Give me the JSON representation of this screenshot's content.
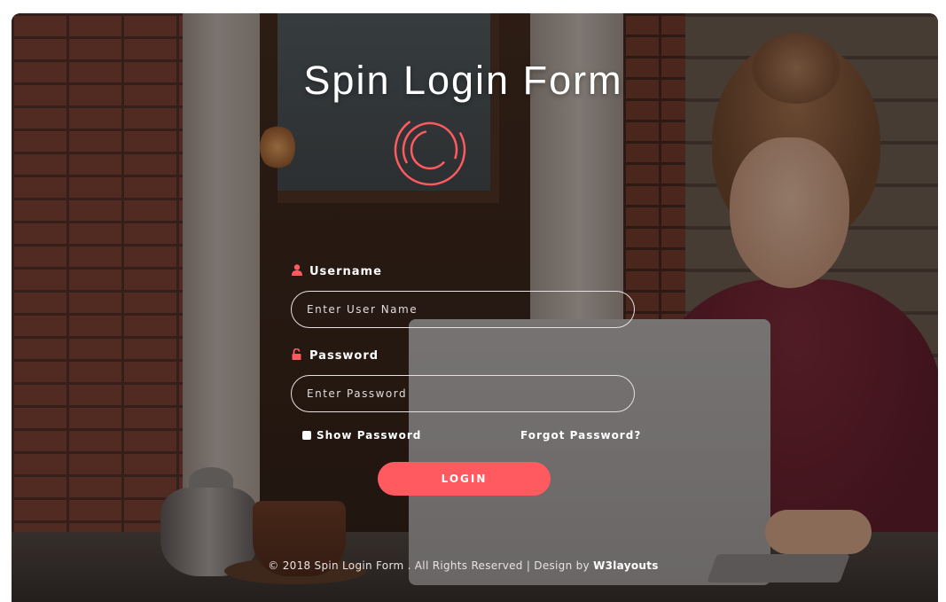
{
  "title": "Spin Login Form",
  "username": {
    "label": "Username",
    "icon": "user-icon",
    "placeholder": "Enter User Name"
  },
  "password": {
    "label": "Password",
    "icon": "lock-icon",
    "placeholder": "Enter Password"
  },
  "show_password_label": "Show Password",
  "forgot_password_label": "Forgot Password?",
  "login_label": "LOGIN",
  "footer": {
    "text": "© 2018 Spin Login Form . All Rights Reserved | Design by",
    "link": "W3layouts"
  },
  "colors": {
    "accent": "#ff5a5f",
    "text": "#ffffff"
  }
}
